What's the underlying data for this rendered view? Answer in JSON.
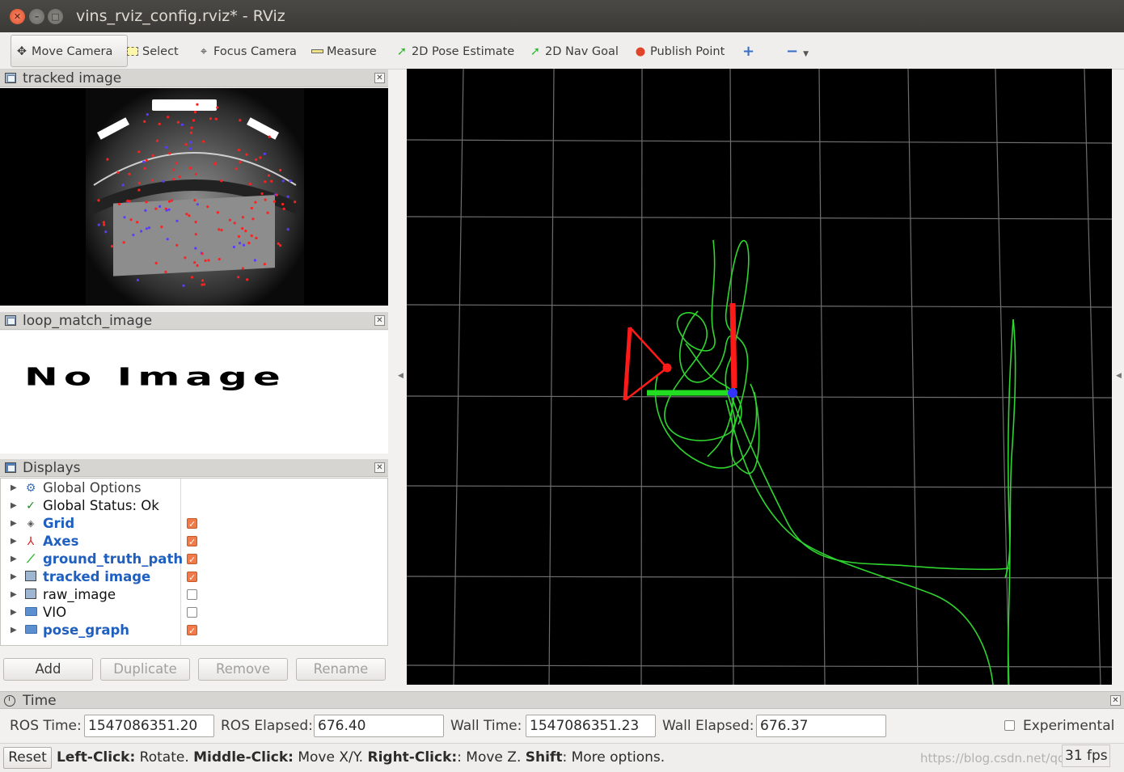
{
  "window": {
    "title": "vins_rviz_config.rviz* - RViz"
  },
  "toolbar": {
    "tools": [
      {
        "label": "Move Camera",
        "icon": "move-camera-icon"
      },
      {
        "label": "Select",
        "icon": "select-icon"
      },
      {
        "label": "Focus Camera",
        "icon": "focus-camera-icon"
      },
      {
        "label": "Measure",
        "icon": "measure-icon"
      },
      {
        "label": "2D Pose Estimate",
        "icon": "pose-estimate-icon"
      },
      {
        "label": "2D Nav Goal",
        "icon": "nav-goal-icon"
      },
      {
        "label": "Publish Point",
        "icon": "publish-point-icon"
      }
    ],
    "add_icon": "plus-icon",
    "remove_icon": "minus-icon"
  },
  "panels": {
    "tracked_image": {
      "title": "tracked image"
    },
    "loop_match_image": {
      "title": "loop_match_image",
      "placeholder": "No Image"
    },
    "displays": {
      "title": "Displays",
      "items": [
        {
          "label": "Global Options",
          "icon": "gear-icon",
          "checked": null,
          "style": "plain"
        },
        {
          "label": "Global Status: Ok",
          "icon": "checkmark-icon",
          "checked": null,
          "style": "black"
        },
        {
          "label": "Grid",
          "icon": "grid-icon",
          "checked": true,
          "style": "blue"
        },
        {
          "label": "Axes",
          "icon": "axes-icon",
          "checked": true,
          "style": "blue"
        },
        {
          "label": "ground_truth_path",
          "icon": "path-icon",
          "checked": true,
          "style": "blue"
        },
        {
          "label": "tracked image",
          "icon": "image-icon",
          "checked": true,
          "style": "blue"
        },
        {
          "label": "raw_image",
          "icon": "image-icon",
          "checked": false,
          "style": "black"
        },
        {
          "label": "VIO",
          "icon": "folder-icon",
          "checked": false,
          "style": "black"
        },
        {
          "label": "pose_graph",
          "icon": "folder-icon",
          "checked": true,
          "style": "blue"
        }
      ],
      "buttons": {
        "add": "Add",
        "duplicate": "Duplicate",
        "remove": "Remove",
        "rename": "Rename"
      }
    }
  },
  "time": {
    "title": "Time",
    "ros_time_label": "ROS Time:",
    "ros_time": "1547086351.20",
    "ros_elapsed_label": "ROS Elapsed:",
    "ros_elapsed": "676.40",
    "wall_time_label": "Wall Time:",
    "wall_time": "1547086351.23",
    "wall_elapsed_label": "Wall Elapsed:",
    "wall_elapsed": "676.37",
    "experimental_label": "Experimental",
    "experimental_checked": false
  },
  "status": {
    "reset_label": "Reset",
    "hint_parts": [
      {
        "bold": "Left-Click:",
        "text": " Rotate. "
      },
      {
        "bold": "Middle-Click:",
        "text": " Move X/Y. "
      },
      {
        "bold": "Right-Click:",
        "text": ": Move Z. "
      },
      {
        "bold": "Shift",
        "text": ": More options."
      }
    ],
    "fps": "31 fps",
    "watermark": "https://blog.csdn.net/qq_..."
  },
  "colors": {
    "grid": "#6e6e6e",
    "path": "#2fd62f",
    "axis_red": "#ff1a1a",
    "axis_green": "#22dd22",
    "axis_blue": "#3333ff",
    "checkbox_on": "#ef7b4a",
    "display_blue": "#1f5fbf"
  }
}
